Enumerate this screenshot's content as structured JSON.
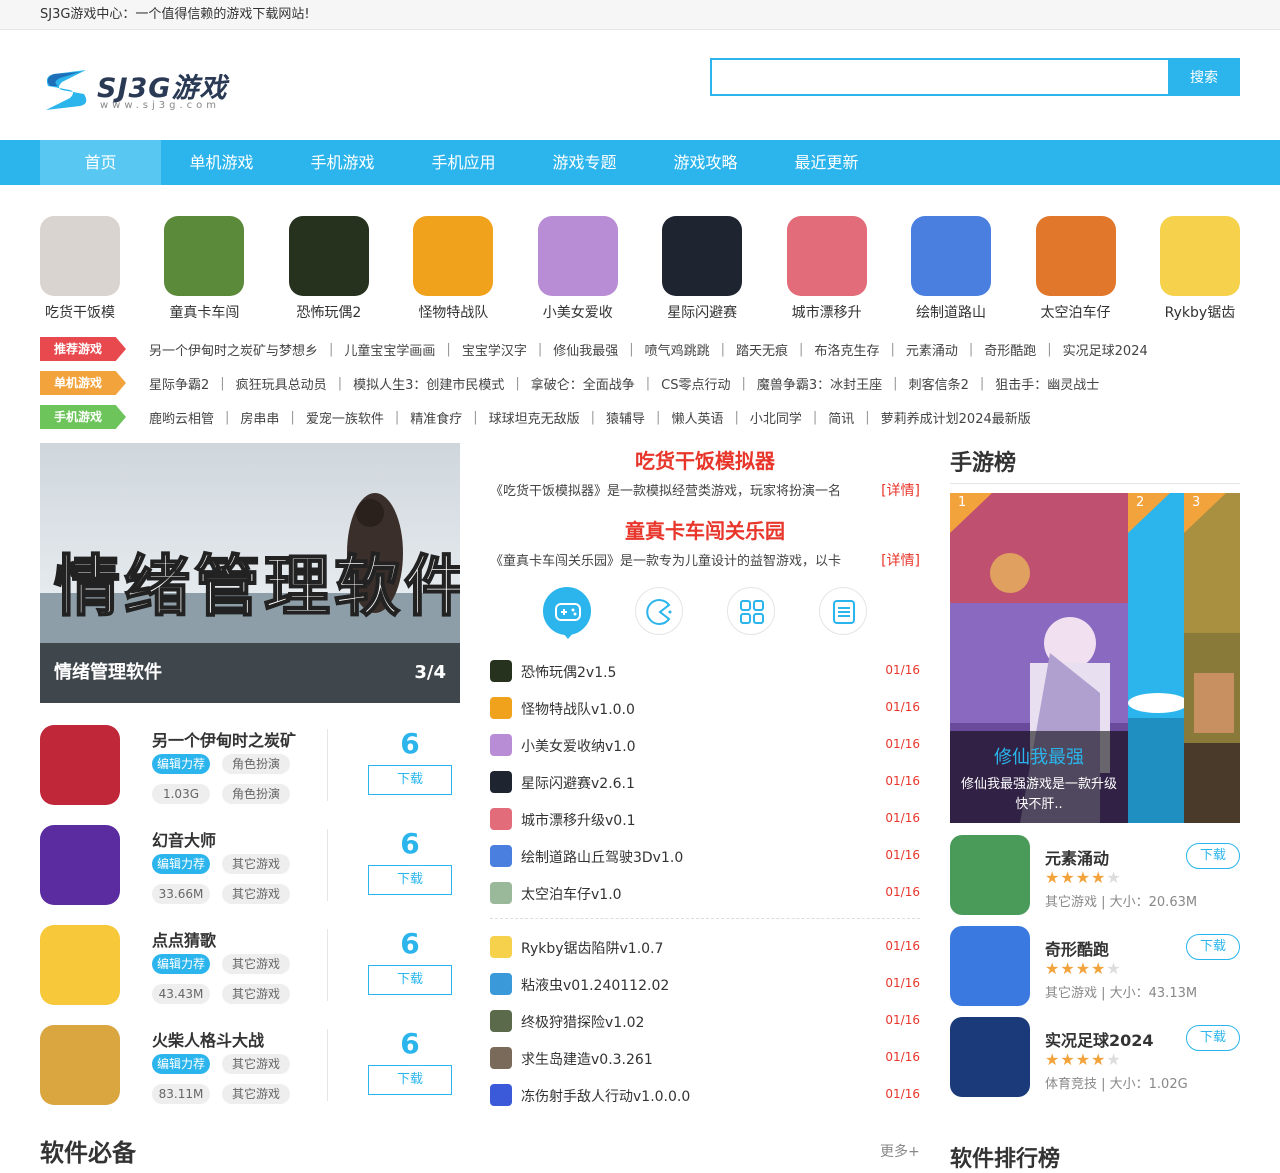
{
  "topbar": {
    "text": "SJ3G游戏中心：一个值得信赖的游戏下载网站!"
  },
  "header": {
    "logo_text": "SJ3G游戏",
    "logo_sub": "www.sj3g.com",
    "search_placeholder": "",
    "search_button": "搜索"
  },
  "nav": [
    {
      "label": "首页"
    },
    {
      "label": "单机游戏"
    },
    {
      "label": "手机游戏"
    },
    {
      "label": "手机应用"
    },
    {
      "label": "游戏专题"
    },
    {
      "label": "游戏攻略"
    },
    {
      "label": "最近更新"
    }
  ],
  "featured_games": [
    {
      "name": "吃货干饭模",
      "color": "#d9d4cf"
    },
    {
      "name": "童真卡车闯",
      "color": "#5b8a3a"
    },
    {
      "name": "恐怖玩偶2",
      "color": "#26321e"
    },
    {
      "name": "怪物特战队",
      "color": "#f0a21c"
    },
    {
      "name": "小美女爱收",
      "color": "#b98cd6"
    },
    {
      "name": "星际闪避赛",
      "color": "#1f2530"
    },
    {
      "name": "城市漂移升",
      "color": "#e26c7a"
    },
    {
      "name": "绘制道路山",
      "color": "#4a7fe0"
    },
    {
      "name": "太空泊车仔",
      "color": "#e0772a"
    },
    {
      "name": "Rykby锯齿",
      "color": "#f6d24c"
    }
  ],
  "tag_rows": [
    {
      "tag": "推荐游戏",
      "color": "#e8494e",
      "items": [
        "另一个伊甸时之炭矿与梦想乡",
        "儿童宝宝学画画",
        "宝宝学汉字",
        "修仙我最强",
        "喷气鸡跳跳",
        "踏天无痕",
        "布洛克生存",
        "元素涌动",
        "奇形酷跑",
        "实况足球2024"
      ]
    },
    {
      "tag": "单机游戏",
      "color": "#f2a33c",
      "items": [
        "星际争霸2",
        "疯狂玩具总动员",
        "模拟人生3：创建市民模式",
        "拿破仑：全面战争",
        "CS零点行动",
        "魔兽争霸3：冰封王座",
        "刺客信条2",
        "狙击手：幽灵战士"
      ]
    },
    {
      "tag": "手机游戏",
      "color": "#6cc45a",
      "items": [
        "鹿哟云相管",
        "房串串",
        "爱宠一族软件",
        "精准食疗",
        "球球坦克无敌版",
        "猿辅导",
        "懒人英语",
        "小北同学",
        "简讯",
        "萝莉养成计划2024最新版"
      ]
    }
  ],
  "banner": {
    "overlay_text": "情绪管理软件",
    "caption": "情绪管理软件",
    "page": "3/4"
  },
  "app_list": [
    {
      "name": "另一个伊甸时之炭矿",
      "badge": "编辑力荐",
      "category": "角色扮演",
      "size": "1.03G",
      "category2": "角色扮演",
      "score": "6",
      "download": "下载",
      "color": "#c0283a"
    },
    {
      "name": "幻音大师",
      "badge": "编辑力荐",
      "category": "其它游戏",
      "size": "33.66M",
      "category2": "其它游戏",
      "score": "6",
      "download": "下载",
      "color": "#5a2ca0"
    },
    {
      "name": "点点猜歌",
      "badge": "编辑力荐",
      "category": "其它游戏",
      "size": "43.43M",
      "category2": "其它游戏",
      "score": "6",
      "download": "下载",
      "color": "#f6c83a"
    },
    {
      "name": "火柴人格斗大战",
      "badge": "编辑力荐",
      "category": "其它游戏",
      "size": "83.11M",
      "category2": "其它游戏",
      "score": "6",
      "download": "下载",
      "color": "#d9a640"
    }
  ],
  "headlines": [
    {
      "title": "吃货干饭模拟器",
      "desc": "《吃货干饭模拟器》是一款模拟经营类游戏，玩家将扮演一名",
      "more": "[详情]"
    },
    {
      "title": "童真卡车闯关乐园",
      "desc": "《童真卡车闯关乐园》是一款专为儿童设计的益智游戏，以卡",
      "more": "[详情]"
    }
  ],
  "category_icons": [
    "gamepad-icon",
    "pacman-icon",
    "grid-icon",
    "document-icon"
  ],
  "news_group1": [
    {
      "title": "恐怖玩偶2v1.5",
      "date": "01/16",
      "color": "#26321e"
    },
    {
      "title": "怪物特战队v1.0.0",
      "date": "01/16",
      "color": "#f0a21c"
    },
    {
      "title": "小美女爱收纳v1.0",
      "date": "01/16",
      "color": "#b98cd6"
    },
    {
      "title": "星际闪避赛v2.6.1",
      "date": "01/16",
      "color": "#1f2530"
    },
    {
      "title": "城市漂移升级v0.1",
      "date": "01/16",
      "color": "#e26c7a"
    },
    {
      "title": "绘制道路山丘驾驶3Dv1.0",
      "date": "01/16",
      "color": "#4a7fe0"
    },
    {
      "title": "太空泊车仔v1.0",
      "date": "01/16",
      "color": "#9ab89a"
    }
  ],
  "news_group2": [
    {
      "title": "Rykby锯齿陷阱v1.0.7",
      "date": "01/16",
      "color": "#f6d24c"
    },
    {
      "title": "粘液虫v01.240112.02",
      "date": "01/16",
      "color": "#3a9ad9"
    },
    {
      "title": "终极狩猎探险v1.02",
      "date": "01/16",
      "color": "#5a6a4a"
    },
    {
      "title": "求生岛建造v0.3.261",
      "date": "01/16",
      "color": "#7a6a5a"
    },
    {
      "title": "冻伤射手敌人行动v1.0.0.0",
      "date": "01/16",
      "color": "#3a5ad9"
    }
  ],
  "sidebar": {
    "title": "手游榜",
    "ranks": [
      {
        "num": "1",
        "name": "修仙我最强",
        "desc": "修仙我最强游戏是一款升级快不肝.."
      },
      {
        "num": "2"
      },
      {
        "num": "3"
      }
    ],
    "apps": [
      {
        "name": "元素涌动",
        "stars": 4,
        "meta": "其它游戏 | 大小：20.63M",
        "download": "下载",
        "color": "#4a9a5a"
      },
      {
        "name": "奇形酷跑",
        "stars": 4,
        "meta": "其它游戏 | 大小：43.13M",
        "download": "下载",
        "color": "#3a7ae0"
      },
      {
        "name": "实况足球2024",
        "stars": 4,
        "meta": "体育竞技 | 大小：1.02G",
        "download": "下载",
        "color": "#1a3a7a"
      }
    ],
    "bottom_title": "软件排行榜"
  },
  "section_bottom": {
    "title": "软件必备",
    "more": "更多+"
  },
  "colors": {
    "accent": "#2bb5ec",
    "red": "#e8362b",
    "orange": "#f2a33c"
  }
}
